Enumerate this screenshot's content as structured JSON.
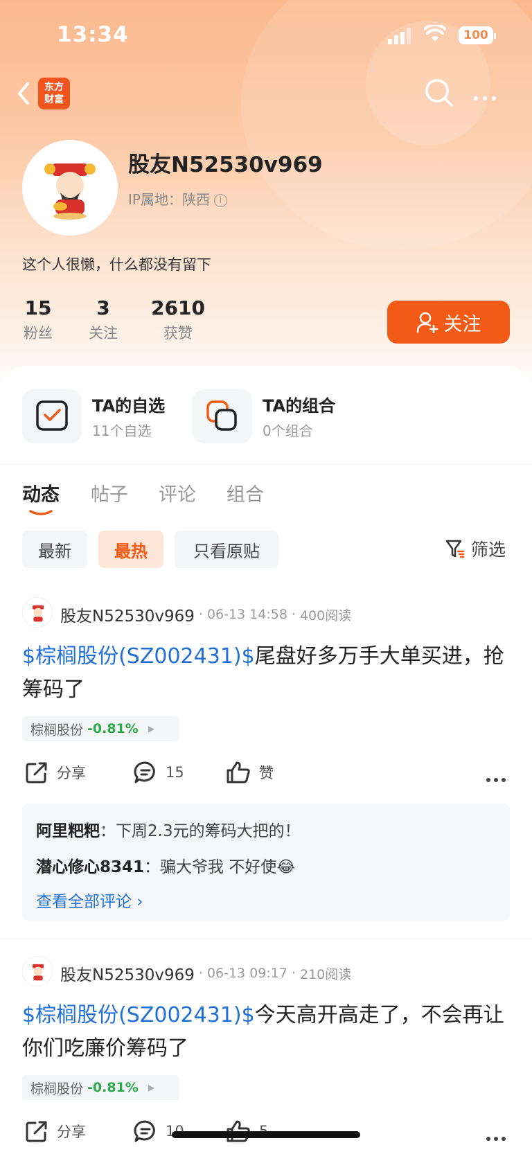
{
  "status": {
    "time": "13:34",
    "battery": "100"
  },
  "header": {
    "logo_line1": "东方",
    "logo_line2": "财富"
  },
  "profile": {
    "username": "股友N52530v969",
    "ip_label": "IP属地：陕西",
    "bio": "这个人很懒，什么都没有留下",
    "stats": [
      {
        "value": "15",
        "label": "粉丝"
      },
      {
        "value": "3",
        "label": "关注"
      },
      {
        "value": "2610",
        "label": "获赞"
      }
    ],
    "follow_label": "关注"
  },
  "quick": [
    {
      "title": "TA的自选",
      "sub": "11个自选"
    },
    {
      "title": "TA的组合",
      "sub": "0个组合"
    }
  ],
  "tabs": [
    "动态",
    "帖子",
    "评论",
    "组合"
  ],
  "chips": [
    "最新",
    "最热",
    "只看原贴"
  ],
  "filter_label": "筛选",
  "posts": [
    {
      "author": "股友N52530v969",
      "date": "06-13 14:58",
      "reads": "400阅读",
      "tag": "$棕榈股份(SZ002431)$",
      "text": "尾盘好多万手大单买进，抢筹码了",
      "stock": "棕榈股份",
      "pct": "-0.81%",
      "share": "分享",
      "comments": "15",
      "likes": "赞"
    },
    {
      "author": "股友N52530v969",
      "date": "06-13 09:17",
      "reads": "210阅读",
      "tag": "$棕榈股份(SZ002431)$",
      "text": "今天高开高走了，不会再让你们吃廉价筹码了",
      "stock": "棕榈股份",
      "pct": "-0.81%",
      "share": "分享",
      "comments": "10",
      "likes": "5"
    }
  ],
  "comment_preview": [
    {
      "user": "阿里粑粑",
      "text": "下周2.3元的筹码大把的！"
    },
    {
      "user": "潜心修心8341",
      "text": "骗大爷我 不好使😂"
    }
  ],
  "view_all": "查看全部评论",
  "colors": {
    "accent": "#f25a16",
    "link": "#1f6fd6",
    "down": "#2eaa4a"
  }
}
